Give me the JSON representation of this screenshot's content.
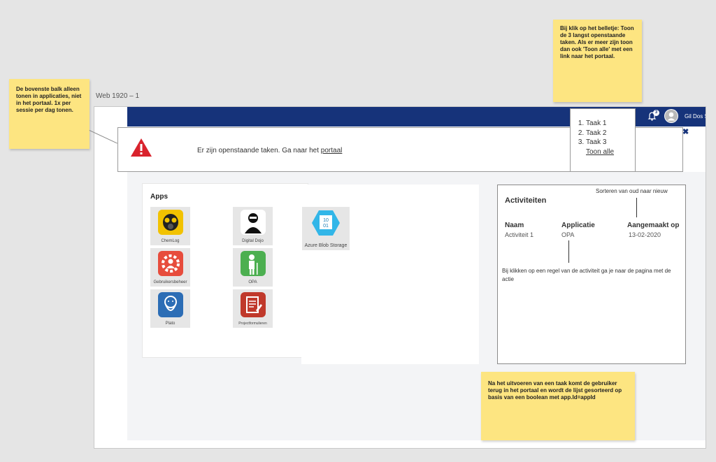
{
  "frame": {
    "label": "Web 1920 – 1"
  },
  "sticky_notes": {
    "top_bar": "De bovenste balk alleen tonen in applicaties, niet in het portaal. 1x per sessie per dag tonen.",
    "bell": "Bij klik op het belletje: Toon de 3 langst openstaande taken. Als er meer zijn toon dan ook 'Toon alle' met een link naar het portaal.",
    "after_task": "Na het uitvoeren van een taak komt de gebruiker terug in het portaal en wordt de lijst gesorteerd op basis van een boolean met app.Id=appId"
  },
  "header": {
    "notification_count": "3",
    "user_name": "Gil Dos Sa"
  },
  "banner": {
    "text": "Er zijn openstaande taken. Ga naar het ",
    "link": "portaal",
    "close": "✖"
  },
  "tasks_dropdown": {
    "items": [
      "Taak 1",
      "Taak 2",
      "Taak 3"
    ],
    "show_all": "Toon alle"
  },
  "apps": {
    "title": "Apps",
    "tiles": [
      {
        "label": "ChemLog",
        "icon": "gas-mask-icon"
      },
      {
        "label": "Digital Dojo",
        "icon": "ninja-icon"
      },
      {
        "label": "Azure Blob Storage",
        "icon": "blob-storage-icon"
      },
      {
        "label": "Gebruikersbeheer",
        "icon": "user-gear-icon"
      },
      {
        "label": "OPA",
        "icon": "elder-person-icon"
      },
      {
        "label": "Plato",
        "icon": "philosopher-icon"
      },
      {
        "label": "Projectformulieren",
        "icon": "form-icon"
      }
    ]
  },
  "activities": {
    "title": "Activiteiten",
    "sort_note": "Sorteren van oud naar nieuw",
    "columns": [
      "Naam",
      "Applicatie",
      "Aangemaakt op"
    ],
    "rows": [
      [
        "Activiteit 1",
        "OPA",
        "13-02-2020"
      ]
    ],
    "click_note": "Bij klikken op een regel van de activiteit ga je naar de pagina met de actie"
  },
  "colors": {
    "topbar": "#16337a",
    "sticky": "#fde581",
    "alert": "#d9232d"
  }
}
